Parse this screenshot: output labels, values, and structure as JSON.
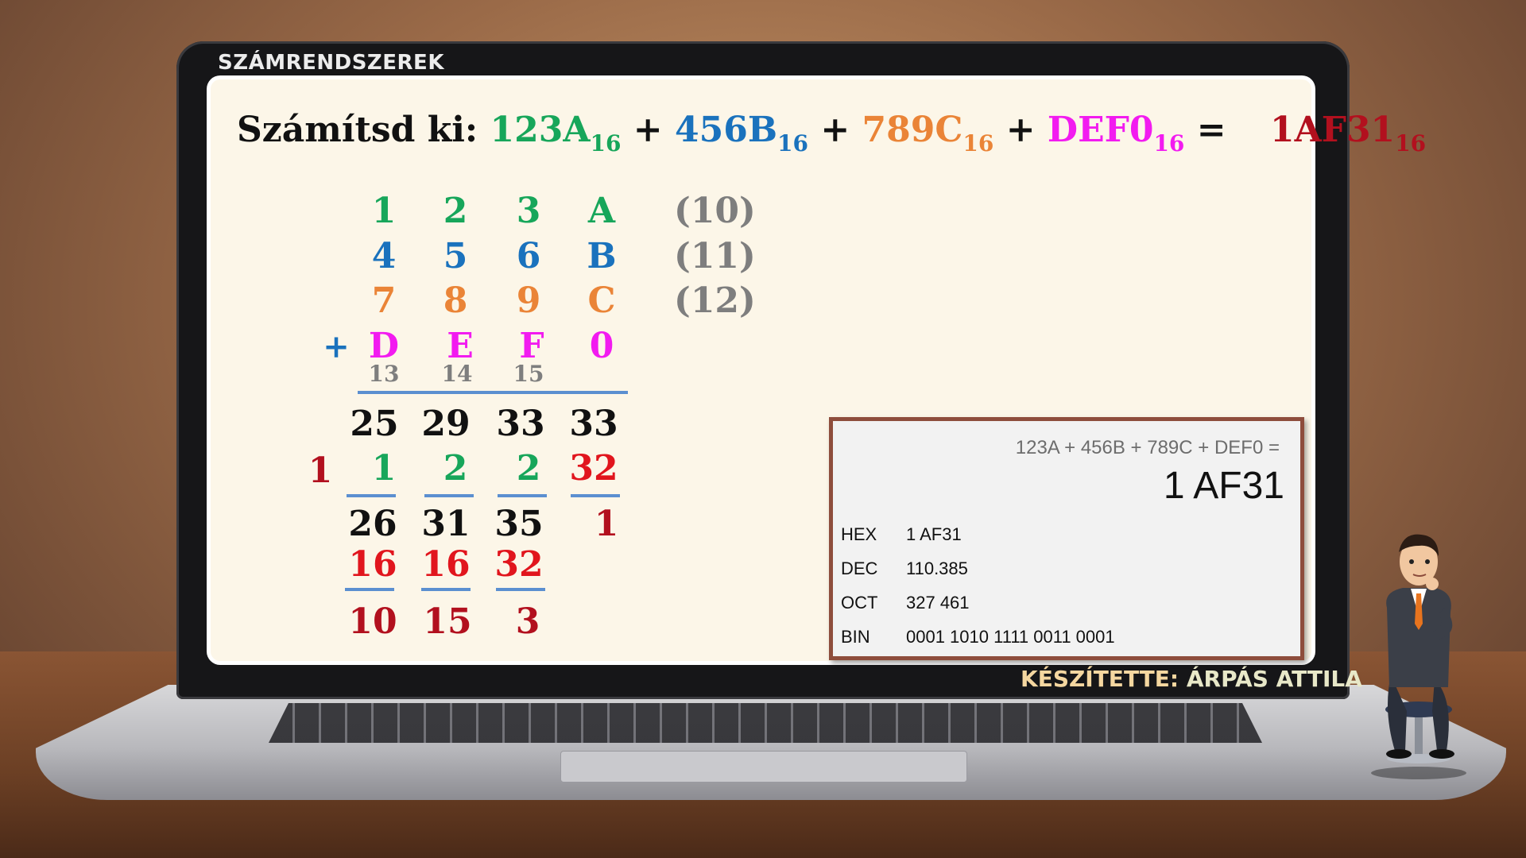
{
  "header": {
    "title": "SZÁMRENDSZEREK"
  },
  "problem": {
    "prefix": "Számítsd ki:",
    "terms": [
      {
        "value": "123A",
        "base": "16"
      },
      {
        "value": "456B",
        "base": "16"
      },
      {
        "value": "789C",
        "base": "16"
      },
      {
        "value": "DEF0",
        "base": "16"
      }
    ],
    "plus": "+",
    "equals": "=",
    "result": {
      "value": "1AF31",
      "base": "16"
    }
  },
  "column_addition": {
    "rows": [
      [
        "1",
        "2",
        "3",
        "A"
      ],
      [
        "4",
        "5",
        "6",
        "B"
      ],
      [
        "7",
        "8",
        "9",
        "C"
      ],
      [
        "D",
        "E",
        "F",
        "0"
      ]
    ],
    "hex_values": [
      "(10)",
      "(11)",
      "(12)"
    ],
    "plus_sign": "+",
    "decimal_hints": [
      "13",
      "14",
      "15"
    ],
    "sums": [
      "25",
      "29",
      "33",
      "33"
    ],
    "carry_lead": "1",
    "carries": [
      "1",
      "2",
      "2",
      "32"
    ],
    "subtotals": [
      "26",
      "31",
      "35",
      "1"
    ],
    "subtract": [
      "16",
      "16",
      "32"
    ],
    "remainders": [
      "10",
      "15",
      "3"
    ]
  },
  "calculator": {
    "expression": "123A + 456B + 789C + DEF0 =",
    "result": "1 AF31",
    "rows": [
      {
        "label": "HEX",
        "value": "1 AF31"
      },
      {
        "label": "DEC",
        "value": "110.385"
      },
      {
        "label": "OCT",
        "value": "327 461"
      },
      {
        "label": "BIN",
        "value": "0001 1010 1111 0011 0001"
      }
    ]
  },
  "footer": {
    "author_label": "KÉSZÍTETTE:",
    "author_name": "ÁRPÁS ATTILA"
  },
  "colors": {
    "green": "#17a65a",
    "blue": "#1a72bd",
    "orange": "#ea8437",
    "magenta": "#f21bf0",
    "darkred": "#b2101e",
    "red": "#e1151d",
    "panel_border": "#8e4d3c"
  },
  "icons": {
    "character": "businessman-thinking-illustration"
  }
}
